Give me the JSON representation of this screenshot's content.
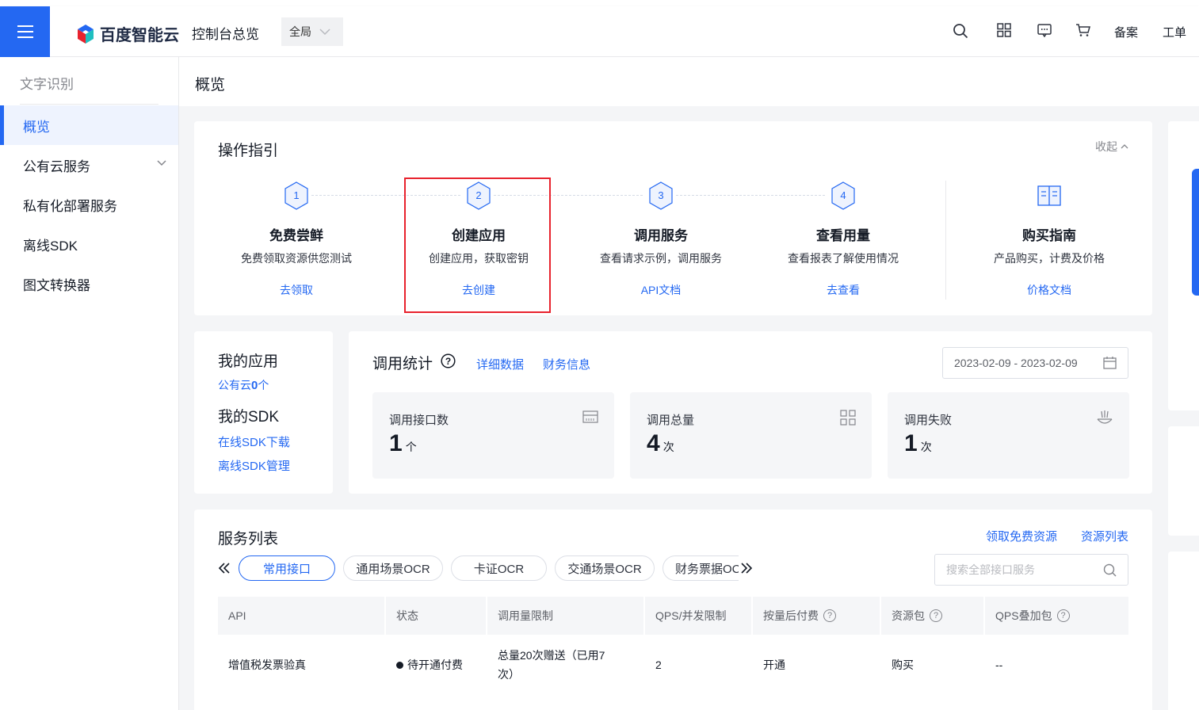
{
  "header": {
    "logo_text": "百度智能云",
    "console_title": "控制台总览",
    "region": "全局",
    "beian": "备案",
    "ticket": "工单"
  },
  "sidebar": {
    "title": "文字识别",
    "items": [
      {
        "label": "概览"
      },
      {
        "label": "公有云服务"
      },
      {
        "label": "私有化部署服务"
      },
      {
        "label": "离线SDK"
      },
      {
        "label": "图文转换器"
      }
    ]
  },
  "page": {
    "title": "概览"
  },
  "guide": {
    "title": "操作指引",
    "collapse": "收起",
    "steps": [
      {
        "num": "1",
        "title": "免费尝鲜",
        "desc": "免费领取资源供您测试",
        "link": "去领取"
      },
      {
        "num": "2",
        "title": "创建应用",
        "desc": "创建应用，获取密钥",
        "link": "去创建"
      },
      {
        "num": "3",
        "title": "调用服务",
        "desc": "查看请求示例，调用服务",
        "link": "API文档"
      },
      {
        "num": "4",
        "title": "查看用量",
        "desc": "查看报表了解使用情况",
        "link": "去查看"
      },
      {
        "num": "",
        "title": "购买指南",
        "desc": "产品购买，计费及价格",
        "link": "价格文档"
      }
    ]
  },
  "my_apps": {
    "title": "我的应用",
    "public_prefix": "公有云",
    "public_count": "0",
    "public_suffix": "个",
    "sdk_title": "我的SDK",
    "sdk_online": "在线SDK下载",
    "sdk_offline": "离线SDK管理"
  },
  "stats": {
    "title": "调用统计",
    "detail_link": "详细数据",
    "finance_link": "财务信息",
    "date_range": "2023-02-09 - 2023-02-09",
    "boxes": [
      {
        "label": "调用接口数",
        "value": "1",
        "unit": "个"
      },
      {
        "label": "调用总量",
        "value": "4",
        "unit": "次"
      },
      {
        "label": "调用失败",
        "value": "1",
        "unit": "次"
      }
    ]
  },
  "services": {
    "title": "服务列表",
    "free_link": "领取免费资源",
    "resource_link": "资源列表",
    "tabs": [
      "常用接口",
      "通用场景OCR",
      "卡证OCR",
      "交通场景OCR",
      "财务票据OCR"
    ],
    "search_placeholder": "搜索全部接口服务",
    "columns": [
      "API",
      "状态",
      "调用量限制",
      "QPS/并发限制",
      "按量后付费",
      "资源包",
      "QPS叠加包"
    ],
    "rows": [
      {
        "api": "增值税发票验真",
        "status": "待开通付费",
        "limit_line1": "总量20次赠送（已用7",
        "limit_line2": "次）",
        "qps": "2",
        "postpaid": "开通",
        "package": "购买",
        "qps_pack": "--"
      }
    ]
  },
  "colors": {
    "primary": "#2468f2",
    "highlight_border": "#e8222d",
    "background": "#f4f5f7"
  }
}
